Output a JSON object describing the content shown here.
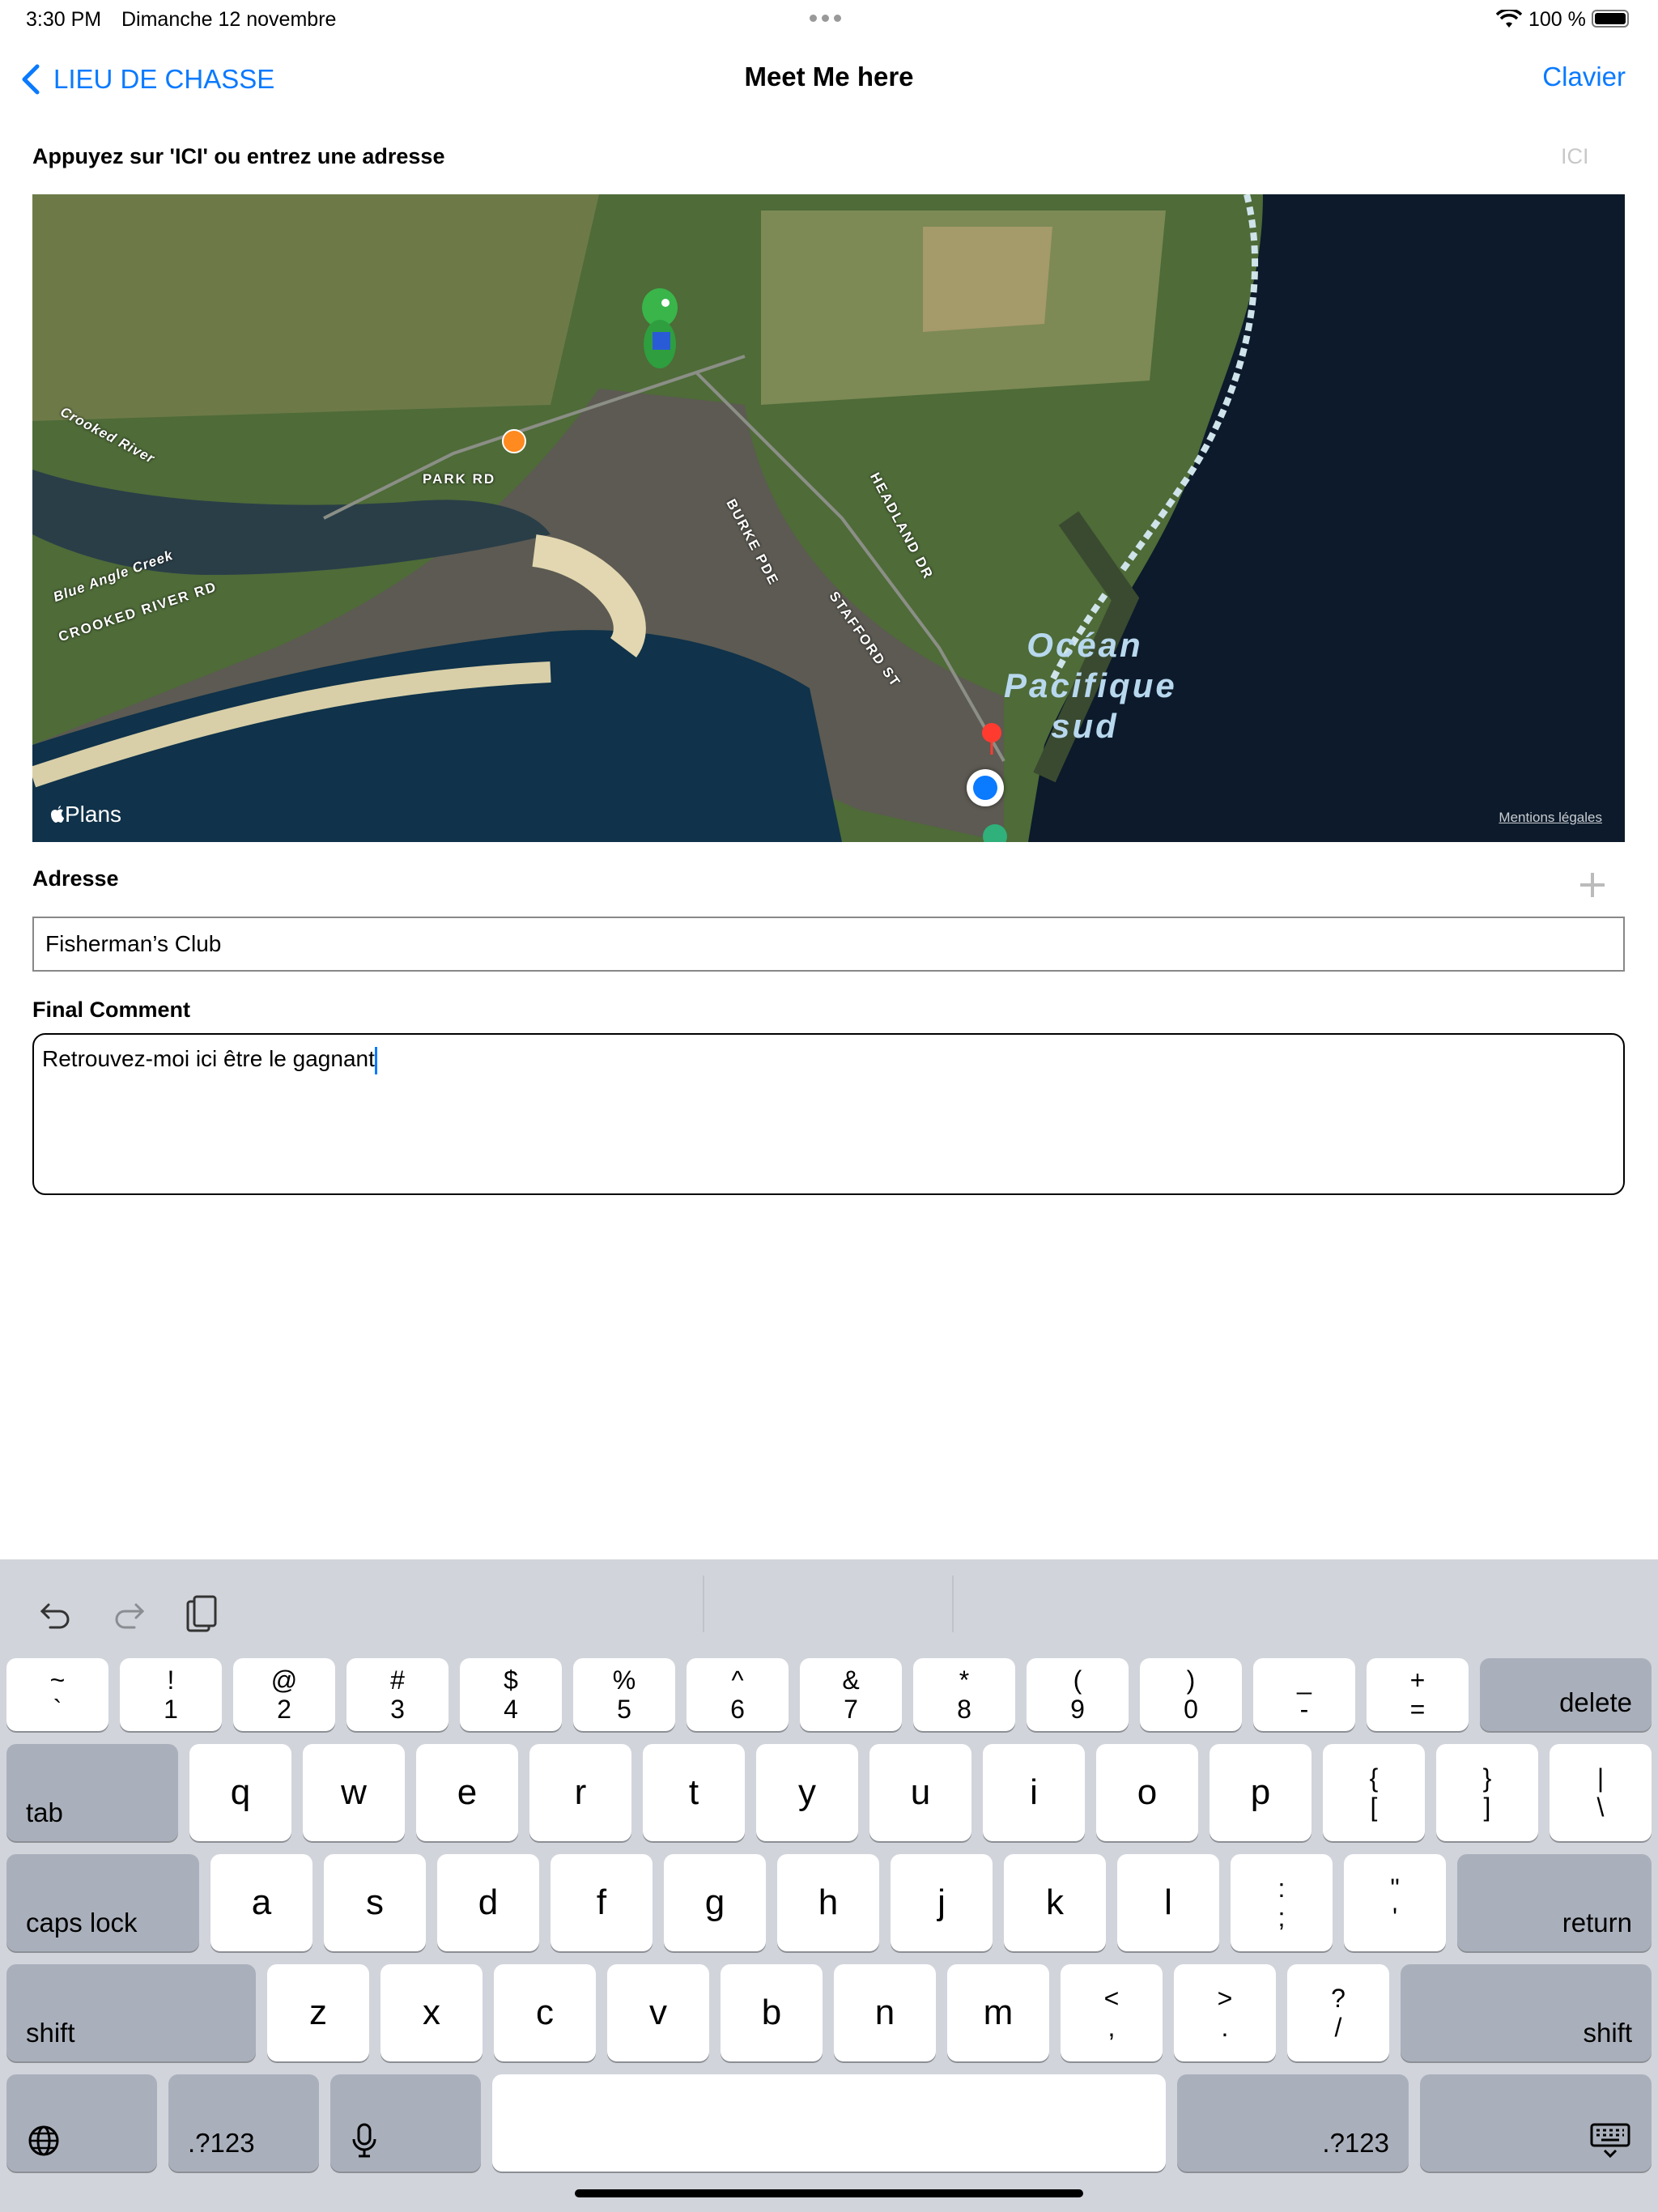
{
  "status": {
    "time": "3:30 PM",
    "date": "Dimanche 12 novembre",
    "battery": "100 %"
  },
  "nav": {
    "back_label": "LIEU DE CHASSE",
    "title": "Meet Me here",
    "right_label": "Clavier"
  },
  "prompt": {
    "text": "Appuyez sur 'ICI' ou entrez une adresse",
    "here_button": "ICI"
  },
  "map": {
    "labels": {
      "crooked_river": "Crooked River",
      "park_rd": "PARK RD",
      "burke_pde": "BURKE PDE",
      "headland_dr": "HEADLAND DR",
      "stafford_st": "STAFFORD ST",
      "blue_angle_creek": "Blue Angle Creek",
      "crooked_river_rd": "CROOKED RIVER RD",
      "ocean_1": "Océan",
      "ocean_2": "Pacifique",
      "ocean_3": "sud"
    },
    "brand": "Plans",
    "legal": "Mentions légales"
  },
  "address": {
    "label": "Adresse",
    "value": "Fisherman’s Club"
  },
  "comment": {
    "label": "Final Comment",
    "value": "Retrouvez-moi ici être le gagnant"
  },
  "keyboard": {
    "row1": [
      {
        "top": "~",
        "bot": "`"
      },
      {
        "top": "!",
        "bot": "1"
      },
      {
        "top": "@",
        "bot": "2"
      },
      {
        "top": "#",
        "bot": "3"
      },
      {
        "top": "$",
        "bot": "4"
      },
      {
        "top": "%",
        "bot": "5"
      },
      {
        "top": "^",
        "bot": "6"
      },
      {
        "top": "&",
        "bot": "7"
      },
      {
        "top": "*",
        "bot": "8"
      },
      {
        "top": "(",
        "bot": "9"
      },
      {
        "top": ")",
        "bot": "0"
      },
      {
        "top": "_",
        "bot": "-"
      },
      {
        "top": "+",
        "bot": "="
      }
    ],
    "delete": "delete",
    "tab": "tab",
    "row2": [
      "q",
      "w",
      "e",
      "r",
      "t",
      "y",
      "u",
      "i",
      "o",
      "p"
    ],
    "row2_sym": [
      {
        "top": "{",
        "bot": "["
      },
      {
        "top": "}",
        "bot": "]"
      },
      {
        "top": "|",
        "bot": "\\"
      }
    ],
    "caps": "caps lock",
    "row3": [
      "a",
      "s",
      "d",
      "f",
      "g",
      "h",
      "j",
      "k",
      "l"
    ],
    "row3_sym": [
      {
        "top": ":",
        "bot": ";"
      },
      {
        "top": "\"",
        "bot": "'"
      }
    ],
    "return": "return",
    "shift": "shift",
    "row4": [
      "z",
      "x",
      "c",
      "v",
      "b",
      "n",
      "m"
    ],
    "row4_sym": [
      {
        "top": "<",
        "bot": ","
      },
      {
        "top": ">",
        "bot": "."
      },
      {
        "top": "?",
        "bot": "/"
      }
    ],
    "numbers": ".?123"
  }
}
